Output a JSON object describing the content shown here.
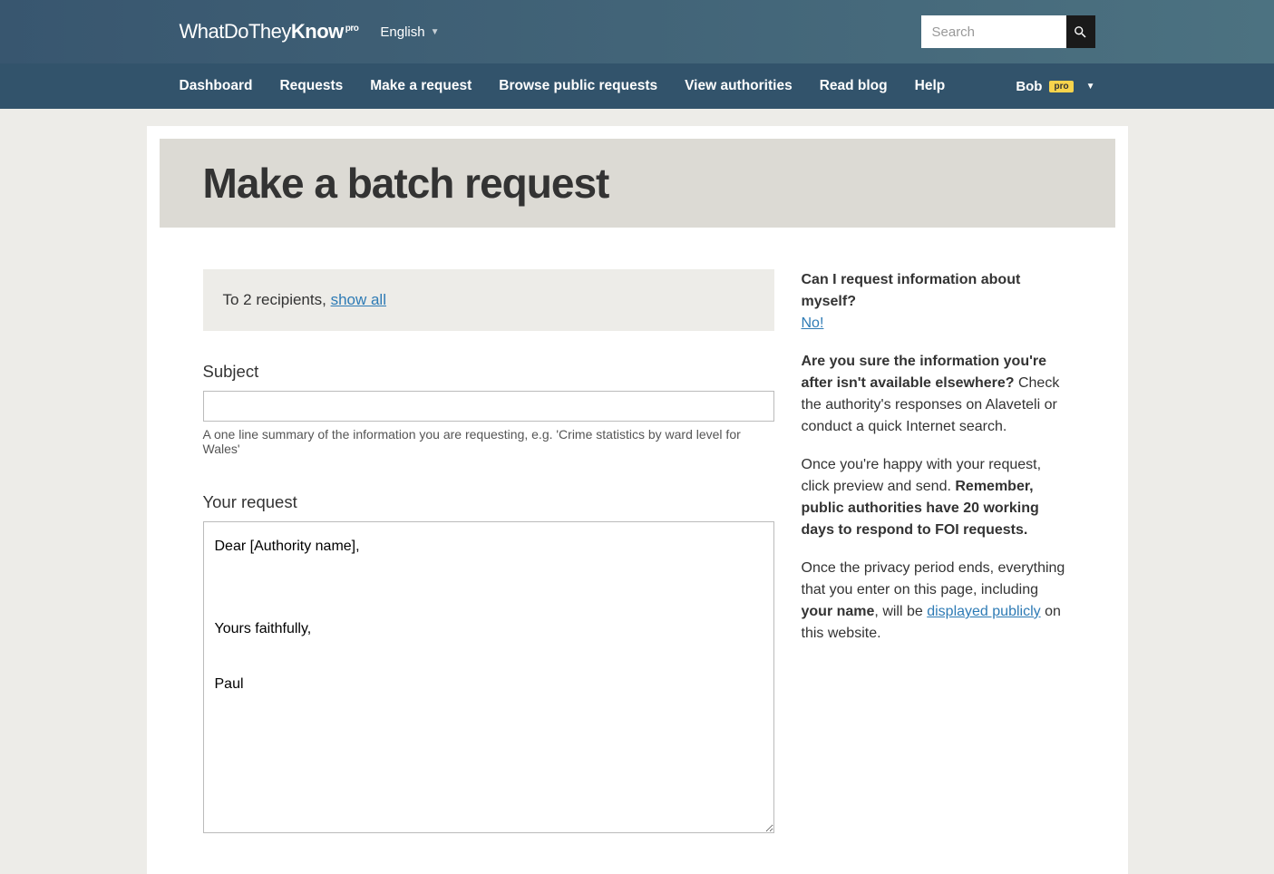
{
  "header": {
    "logo_part1": "WhatDoThey",
    "logo_part2": "Know",
    "logo_pro": "pro",
    "language": "English",
    "search_placeholder": "Search"
  },
  "nav": {
    "items": [
      "Dashboard",
      "Requests",
      "Make a request",
      "Browse public requests",
      "View authorities",
      "Read blog",
      "Help"
    ],
    "user_name": "Bob",
    "pro_badge": "pro"
  },
  "page": {
    "title": "Make a batch request"
  },
  "recipients": {
    "prefix": "To 2 recipients, ",
    "link": "show all"
  },
  "form": {
    "subject_label": "Subject",
    "subject_value": "",
    "subject_hint": "A one line summary of the information you are requesting, e.g. 'Crime statistics by ward level for Wales'",
    "request_label": "Your request",
    "request_value": "Dear [Authority name],\n\n\nYours faithfully,\n\nPaul"
  },
  "sidebar": {
    "q1_bold": "Can I request information about myself?",
    "q1_link": "No!",
    "q2_bold": "Are you sure the information you're after isn't available elsewhere?",
    "q2_text": " Check the authority's responses on Alaveteli or conduct a quick Internet search.",
    "p3_text1": "Once you're happy with your request, click preview and send. ",
    "p3_bold": "Remember, public authorities have 20 working days to respond to FOI requests.",
    "p4_text1": "Once the privacy period ends, everything that you enter on this page, including ",
    "p4_bold": "your name",
    "p4_text2": ", will be ",
    "p4_link": "displayed publicly",
    "p4_text3": " on this website."
  }
}
